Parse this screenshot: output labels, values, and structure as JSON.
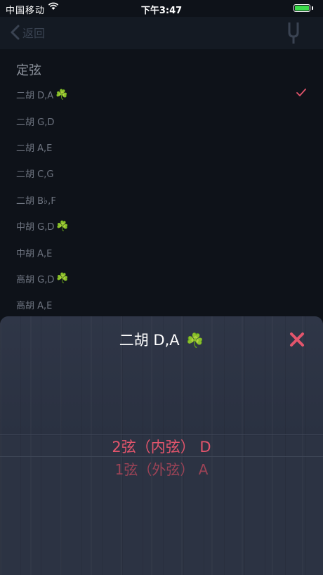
{
  "status_bar": {
    "carrier": "中国移动",
    "time": "下午3:47"
  },
  "nav": {
    "back_label": "返回"
  },
  "section_title": "定弦",
  "tunings": [
    {
      "label": "二胡 D,A",
      "clover": true,
      "checked": true
    },
    {
      "label": "二胡 G,D",
      "clover": false,
      "checked": false
    },
    {
      "label": "二胡 A,E",
      "clover": false,
      "checked": false
    },
    {
      "label": "二胡 C,G",
      "clover": false,
      "checked": false
    },
    {
      "label": "二胡 B♭,F",
      "clover": false,
      "checked": false
    },
    {
      "label": "中胡 G,D",
      "clover": true,
      "checked": false
    },
    {
      "label": "中胡 A,E",
      "clover": false,
      "checked": false
    },
    {
      "label": "高胡 G,D",
      "clover": true,
      "checked": false
    },
    {
      "label": "高胡 A,E",
      "clover": false,
      "checked": false
    }
  ],
  "sheet": {
    "title": "二胡 D,A",
    "title_clover": "☘️",
    "selected_string": "2弦（内弦） D",
    "next_string": "1弦（外弦） A"
  },
  "colors": {
    "accent": "#e3556c",
    "clover": "#3f9c3f",
    "sheet_bg": "#2c3343",
    "page_bg": "#0e1219"
  },
  "icons": {
    "clover": "☘️"
  }
}
